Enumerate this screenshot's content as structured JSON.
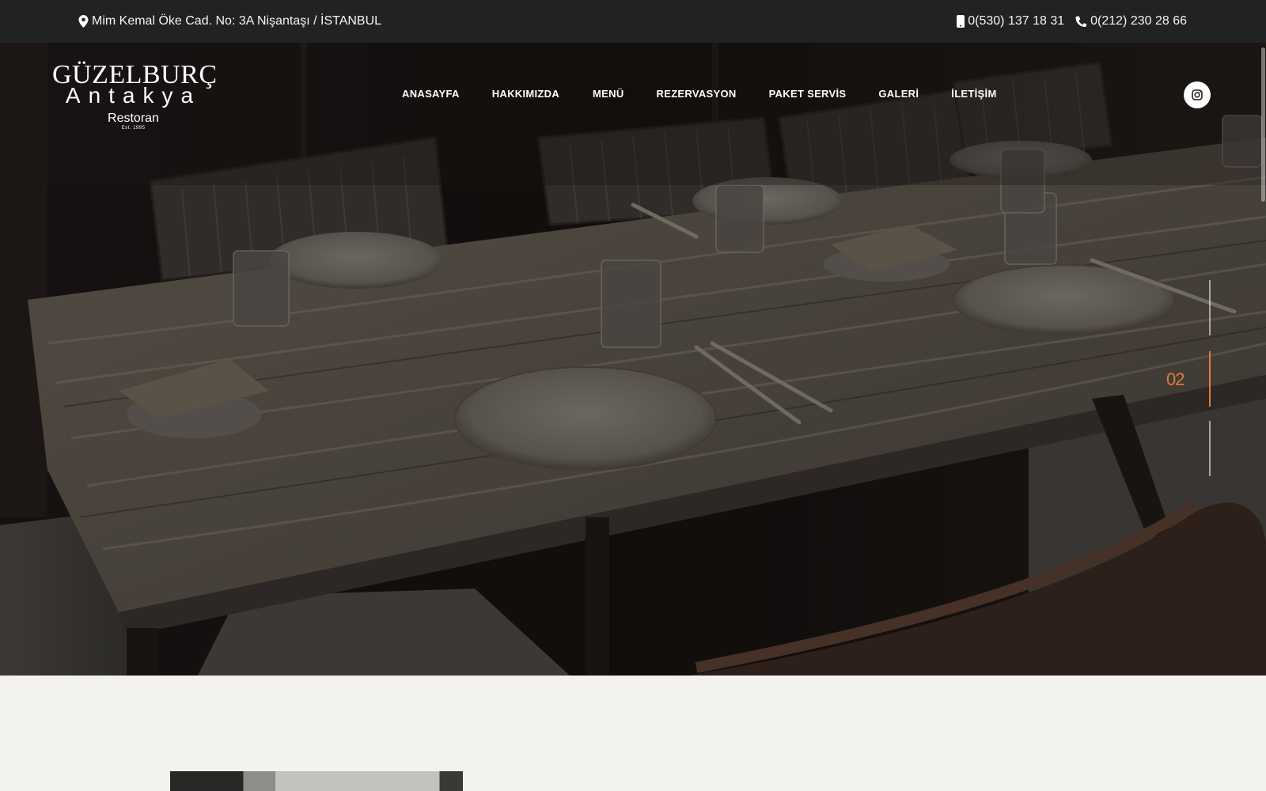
{
  "topbar": {
    "address": "Mim Kemal Öke Cad. No: 3A Nişantaşı / İSTANBUL",
    "mobile_phone": "0(530) 137 18 31",
    "landline_phone": "0(212) 230 28 66"
  },
  "logo": {
    "line1": "GÜZELBURÇ",
    "line2": "Antakya",
    "line3": "Restoran",
    "line4": "Est. 1995"
  },
  "nav": {
    "items": [
      {
        "label": "ANASAYFA"
      },
      {
        "label": "HAKKIMIZDA"
      },
      {
        "label": "MENÜ"
      },
      {
        "label": "REZERVASYON"
      },
      {
        "label": "PAKET SERVİS"
      },
      {
        "label": "GALERİ"
      },
      {
        "label": "İLETİŞİM"
      }
    ]
  },
  "slider": {
    "current": "02"
  },
  "colors": {
    "topbar_bg": "#222222",
    "accent": "#e07a3f",
    "page_bg": "#f3f2ee"
  }
}
